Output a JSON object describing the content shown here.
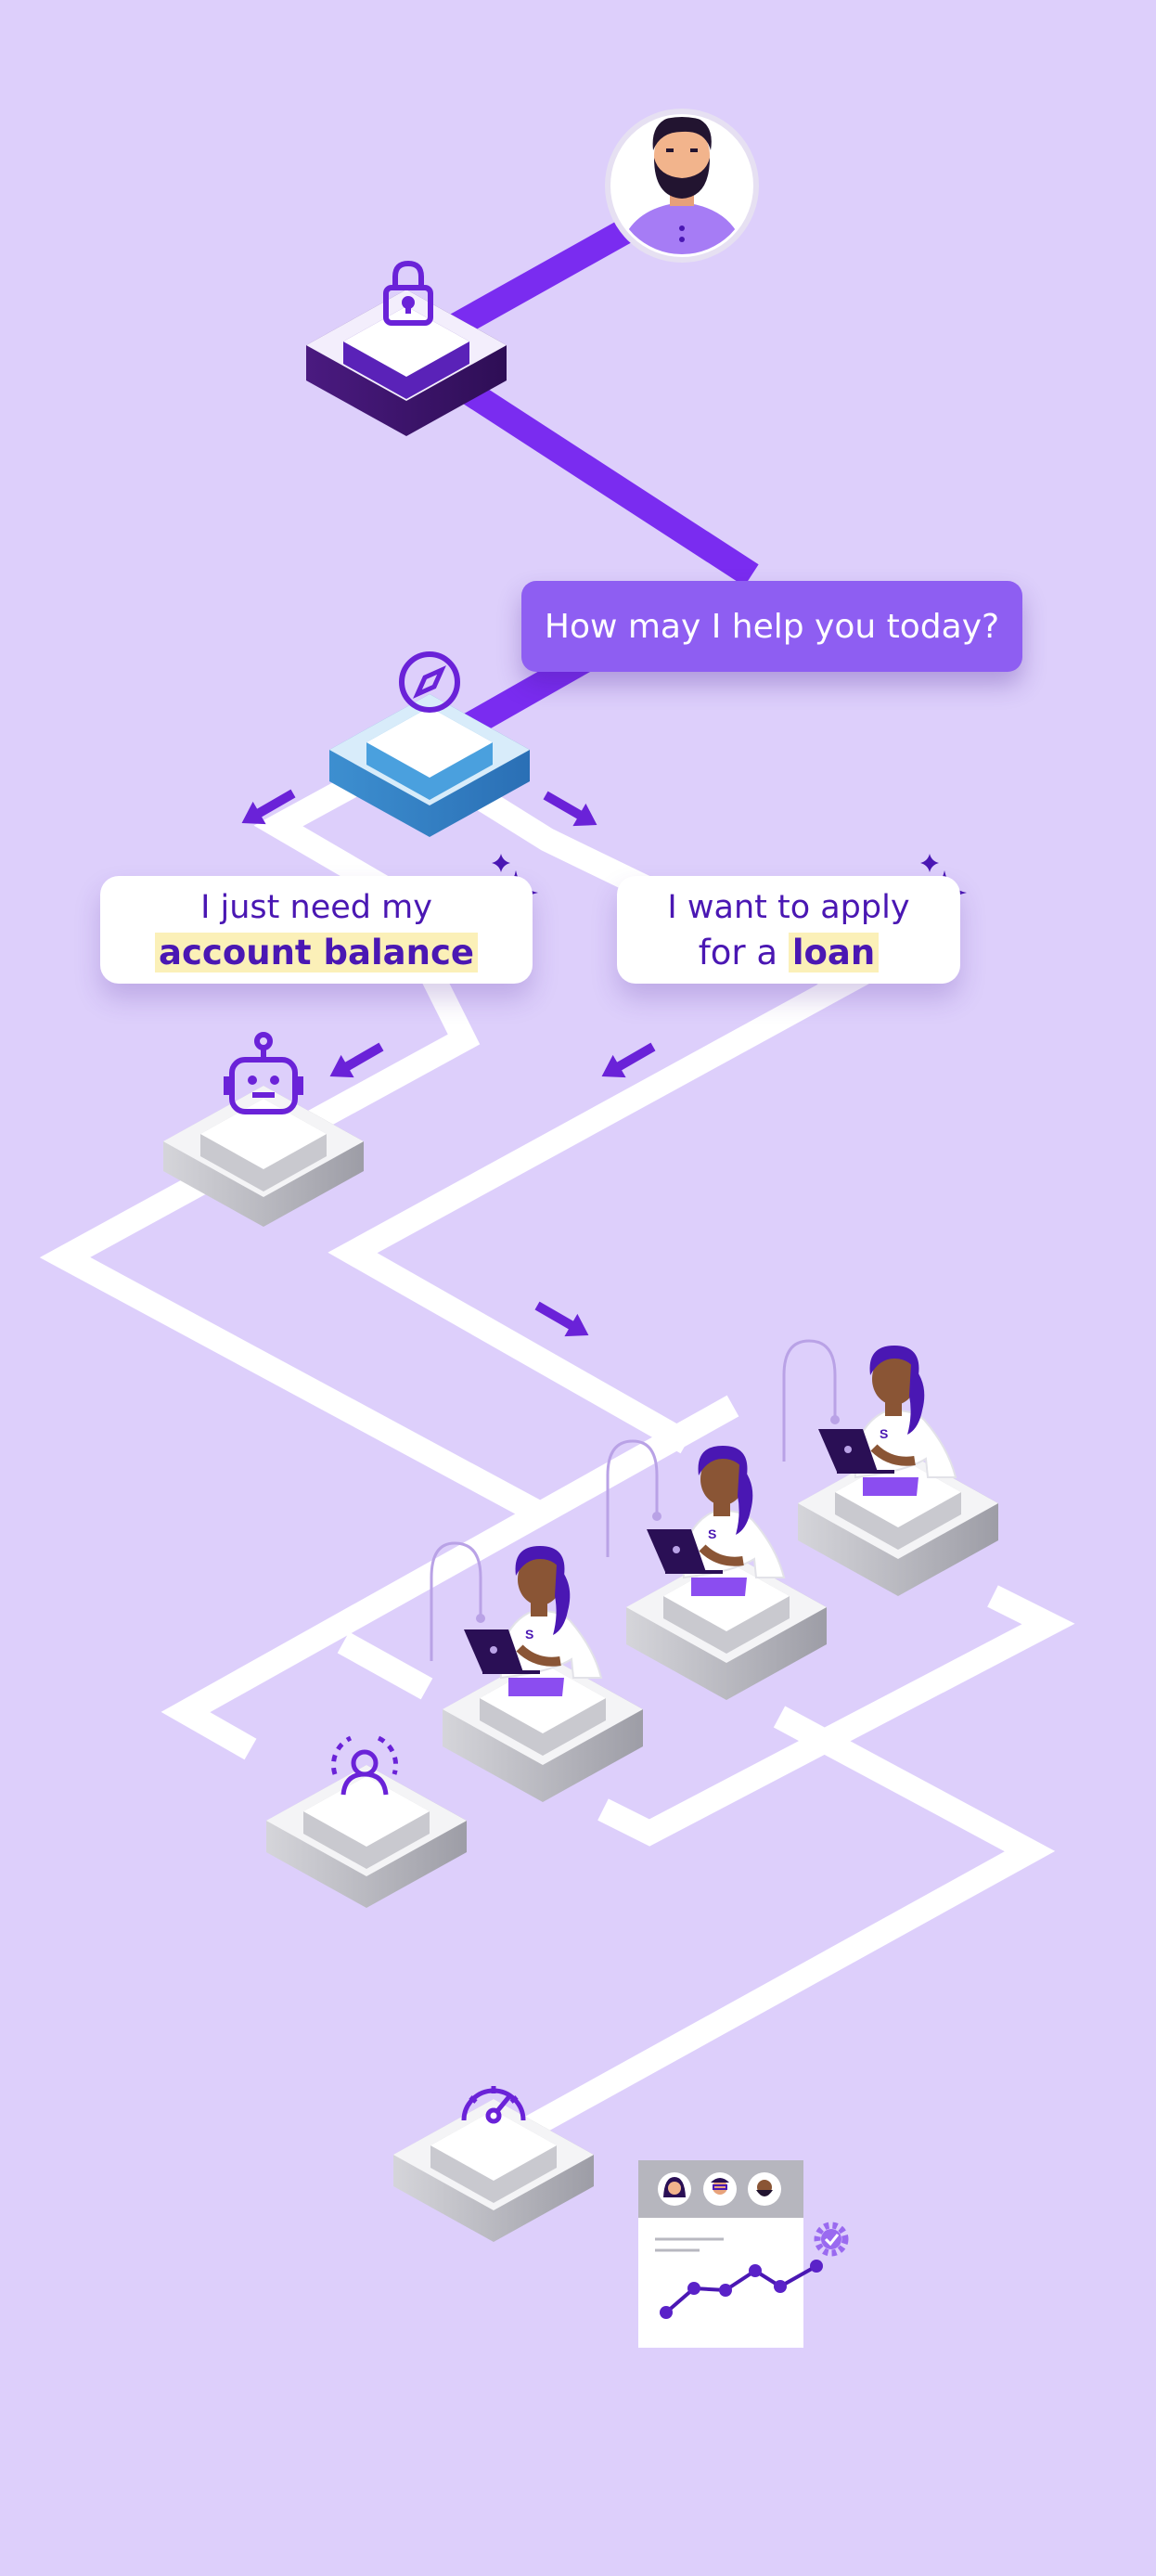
{
  "prompt": {
    "text": "How may I help you today?"
  },
  "choices": {
    "balance": {
      "line1": "I just need my",
      "line2_highlight": "account balance"
    },
    "loan": {
      "line1": "I want to apply",
      "line2_prefix": "for a ",
      "line2_highlight": "loan"
    }
  },
  "agent_badge": "S",
  "colors": {
    "background": "#ddcffb",
    "brand_purple": "#7a2cf0",
    "dark_purple": "#4a17b3",
    "bubble_purple": "#8e5ef2",
    "highlight_yellow": "#fbf0b8",
    "platform_blue": "#4aa0de",
    "platform_dark": "#4a1a80",
    "platform_white": "#f4f4f6"
  },
  "icons": [
    "user-avatar-icon",
    "lock-icon",
    "compass-icon",
    "sparkle-icon",
    "robot-icon",
    "agent-icon",
    "person-target-icon",
    "speedometer-icon",
    "dashboard-chart-icon",
    "gear-check-icon",
    "arrow-icon"
  ]
}
